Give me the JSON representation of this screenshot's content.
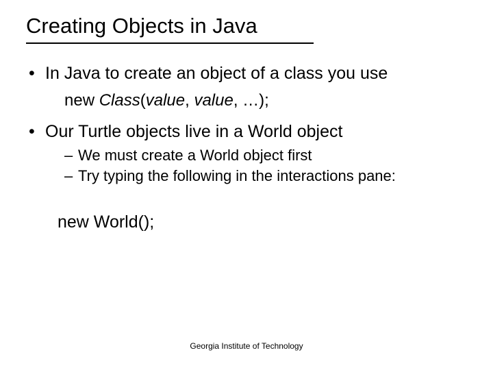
{
  "title": "Creating Objects in Java",
  "b1": "In Java to create an object of a class you use",
  "code_prefix": "new ",
  "code_italic": "Class",
  "code_mid": "(",
  "code_val1": "value",
  "code_sep": ", ",
  "code_val2": "value",
  "code_tail": ", …);",
  "b2": "Our Turtle objects live in a World object",
  "s1": "We must create a World object first",
  "s2": "Try typing the following in the interactions pane:",
  "code2": "new World();",
  "footer": "Georgia Institute of Technology"
}
